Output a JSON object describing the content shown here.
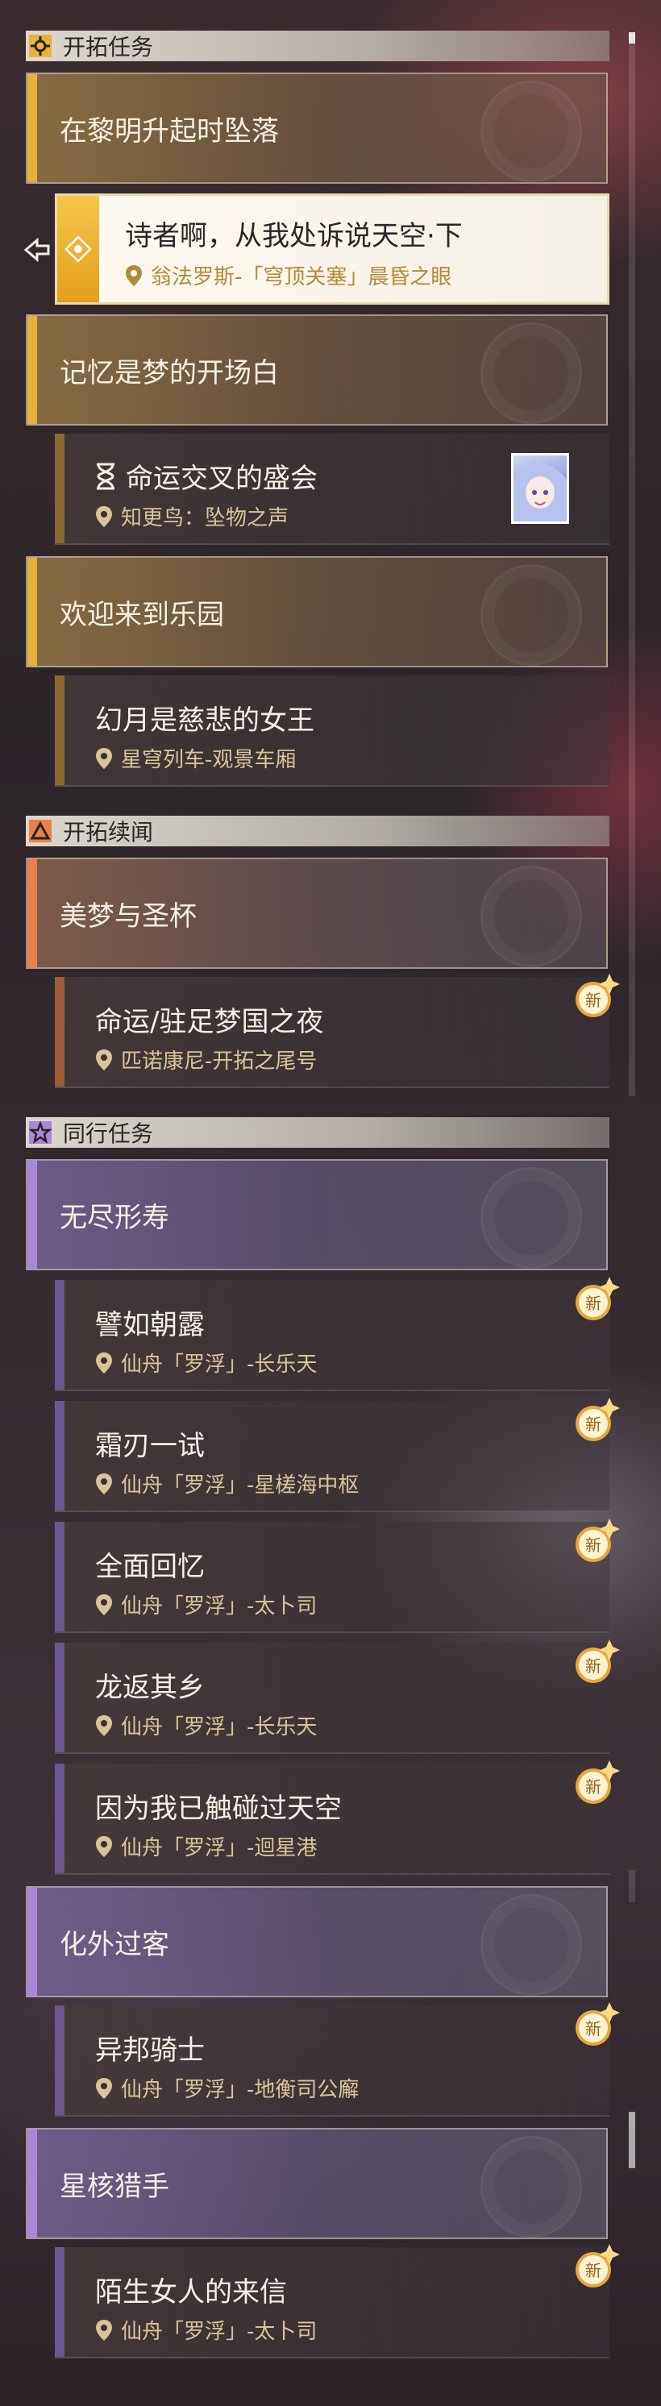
{
  "sections": [
    {
      "label": "开拓任务",
      "icon": "trailblaze-icon"
    },
    {
      "label": "开拓续闻",
      "icon": "triangle-icon"
    },
    {
      "label": "同行任务",
      "icon": "star-icon"
    }
  ],
  "groups": {
    "g1": "在黎明升起时坠落",
    "g2": "记忆是梦的开场白",
    "g3": "欢迎来到乐园",
    "g4": "美梦与圣杯",
    "g5": "无尽形寿",
    "g6": "化外过客",
    "g7": "星核猎手"
  },
  "quests": {
    "q1": {
      "title": "诗者啊，从我处诉说天空·下",
      "location": "翁法罗斯-「穹顶关塞」晨昏之眼"
    },
    "q2": {
      "title": "命运交叉的盛会",
      "location": "知更鸟：坠物之声"
    },
    "q3": {
      "title": "幻月是慈悲的女王",
      "location": "星穹列车-观景车厢"
    },
    "q4": {
      "title": "命运/驻足梦国之夜",
      "location": "匹诺康尼-开拓之尾号"
    },
    "q5": {
      "title": "譬如朝露",
      "location": "仙舟「罗浮」-长乐天"
    },
    "q6": {
      "title": "霜刃一试",
      "location": "仙舟「罗浮」-星槎海中枢"
    },
    "q7": {
      "title": "全面回忆",
      "location": "仙舟「罗浮」-太卜司"
    },
    "q8": {
      "title": "龙返其乡",
      "location": "仙舟「罗浮」-长乐天"
    },
    "q9": {
      "title": "因为我已触碰过天空",
      "location": "仙舟「罗浮」-迴星港"
    },
    "q10": {
      "title": "异邦骑士",
      "location": "仙舟「罗浮」-地衡司公廨"
    },
    "q11": {
      "title": "陌生女人的来信",
      "location": "仙舟「罗浮」-太卜司"
    }
  },
  "new_badge": "新",
  "colors": {
    "gold": "#e6b13a",
    "orange": "#e8824a",
    "purple": "#a887d8",
    "location": "#d9c49a"
  }
}
